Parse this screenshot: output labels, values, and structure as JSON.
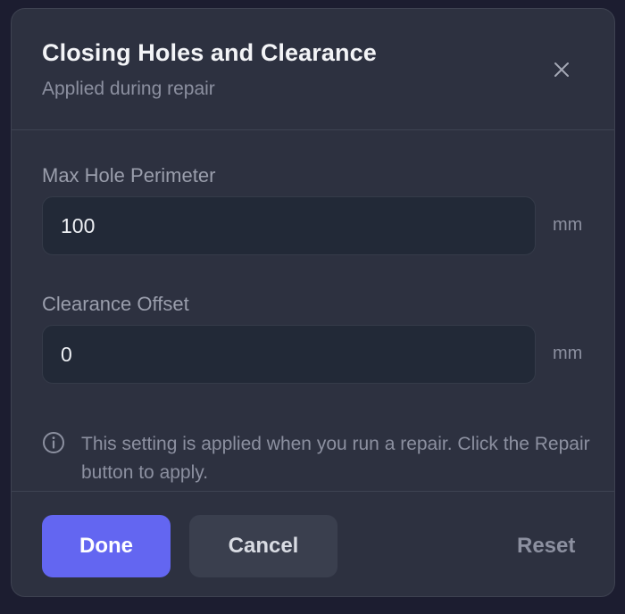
{
  "dialog": {
    "title": "Closing Holes and Clearance",
    "subtitle": "Applied during repair",
    "close_icon": "close-icon"
  },
  "fields": [
    {
      "label": "Max Hole Perimeter",
      "value": "100",
      "unit": "mm"
    },
    {
      "label": "Clearance Offset",
      "value": "0",
      "unit": "mm"
    }
  ],
  "info": {
    "icon": "info-icon",
    "text": "This setting is applied when you run a repair. Click the Repair button to apply."
  },
  "footer": {
    "done_label": "Done",
    "cancel_label": "Cancel",
    "reset_label": "Reset"
  },
  "colors": {
    "accent": "#6366f1",
    "panel": "#2d3140",
    "input_bg": "#222937",
    "muted_text": "#8c90a0"
  }
}
